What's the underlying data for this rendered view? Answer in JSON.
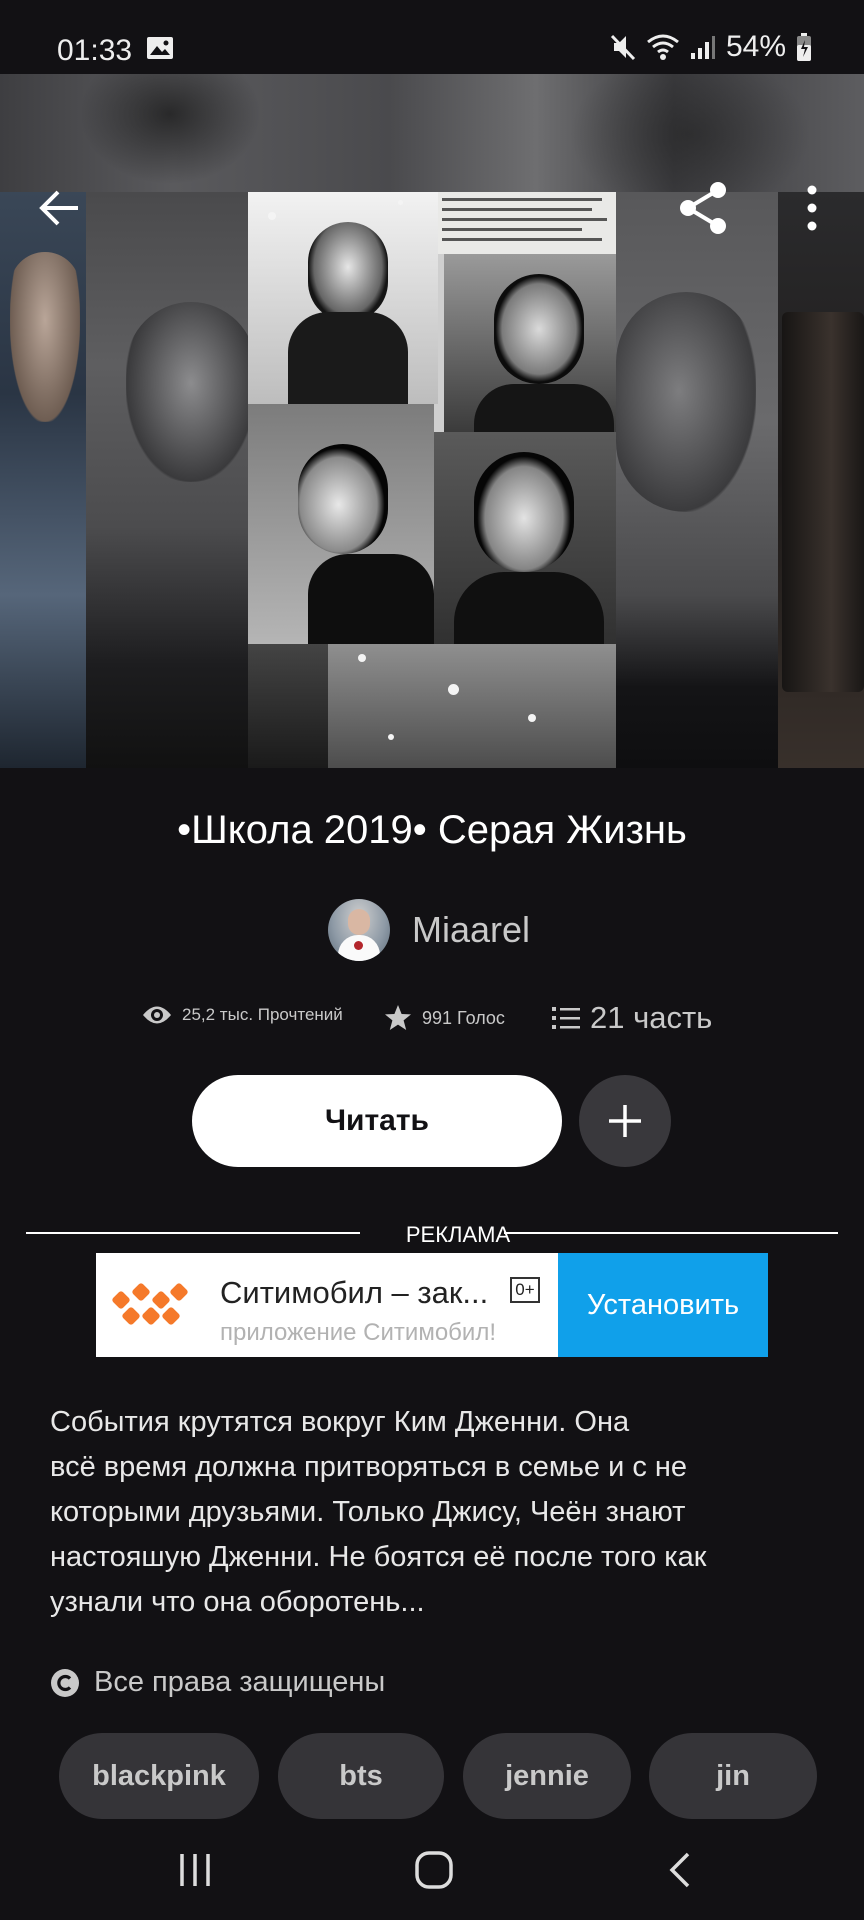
{
  "status_bar": {
    "time": "01:33",
    "battery": "54%",
    "icons": [
      "gallery-icon",
      "mute-icon",
      "wifi-icon",
      "signal-icon",
      "battery-icon"
    ]
  },
  "toolbar": {
    "icons": [
      "back-arrow-icon",
      "share-icon",
      "more-vert-icon"
    ]
  },
  "story": {
    "title": "•Школа 2019• Серая Жизнь",
    "author": "Miaarel",
    "reads": "25,2 тыс. Прочтений",
    "votes": "991 Голос",
    "parts": "21 часть",
    "read_label": "Читать",
    "description_lines": [
      "События крутятся вокруг Ким Дженни. Она",
      "всё время должна притворяться в семье и с не",
      "которыми друзьями. Только Джису, Чеён знают",
      "настояшую Дженни. Не боятся её после того как",
      "узнали что она оборотень..."
    ],
    "rights": "Все права защищены",
    "tags": [
      "blackpink",
      "bts",
      "jennie",
      "jin"
    ]
  },
  "ad": {
    "label": "РЕКЛАМА",
    "title": "Ситимобил – зак...",
    "age": "0+",
    "subtitle": "приложение Ситимобил!",
    "install_label": "Установить",
    "accent": "#10a0ea",
    "logo_color": "#f5792a"
  },
  "nav_bar": {
    "icons": [
      "recent-apps-icon",
      "home-icon",
      "back-icon"
    ]
  }
}
